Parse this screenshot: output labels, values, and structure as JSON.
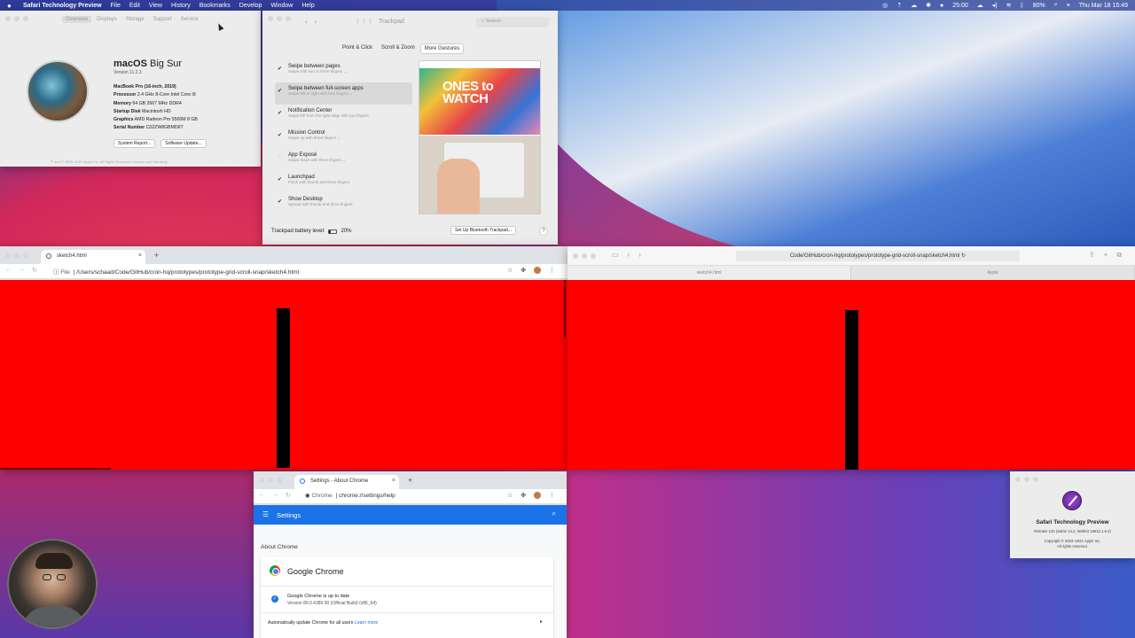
{
  "menubar": {
    "app_name": "Safari Technology Preview",
    "items": [
      "File",
      "Edit",
      "View",
      "History",
      "Bookmarks",
      "Develop",
      "Window",
      "Help"
    ],
    "timer": "25:00",
    "battery": "80%",
    "datetime": "Thu Mar 18  15:49"
  },
  "about_mac": {
    "tabs": [
      "Overview",
      "Displays",
      "Storage",
      "Support",
      "Service"
    ],
    "os_name_prefix": "macOS",
    "os_name_suffix": "Big Sur",
    "version": "Version 11.2.3",
    "model": "MacBook Pro (16-inch, 2019)",
    "specs": [
      {
        "k": "Processor",
        "v": "2.4 GHz 8-Core Intel Core i9"
      },
      {
        "k": "Memory",
        "v": "64 GB 2667 MHz DDR4"
      },
      {
        "k": "Startup Disk",
        "v": "Macintosh HD"
      },
      {
        "k": "Graphics",
        "v": "AMD Radeon Pro 5500M 8 GB"
      },
      {
        "k": "Serial Number",
        "v": "C02ZW8GBMD6T"
      }
    ],
    "system_report": "System Report...",
    "software_update": "Software Update...",
    "footer": "™ and © 1983–2021 Apple Inc. All Rights Reserved. License and Warranty"
  },
  "trackpad": {
    "title": "Trackpad",
    "search_placeholder": "Search",
    "tabs": [
      "Point & Click",
      "Scroll & Zoom",
      "More Gestures"
    ],
    "selected_tab": "More Gestures",
    "options": [
      {
        "name": "Swipe between pages",
        "desc": "Swipe with two or three fingers ⌄"
      },
      {
        "name": "Swipe between full-screen apps",
        "desc": "Swipe left or right with four fingers ⌄"
      },
      {
        "name": "Notification Center",
        "desc": "Swipe left from the right edge with two fingers"
      },
      {
        "name": "Mission Control",
        "desc": "Swipe up with three fingers ⌄"
      },
      {
        "name": "App Exposé",
        "desc": "Swipe down with three fingers ⌄"
      },
      {
        "name": "Launchpad",
        "desc": "Pinch with thumb and three fingers"
      },
      {
        "name": "Show Desktop",
        "desc": "Spread with thumb and three fingers"
      }
    ],
    "preview_text": "ONES to WATCH",
    "battery_label": "Trackpad battery level:",
    "battery_value": "20%",
    "battery_level": 0.2,
    "setup_button": "Set Up Bluetooth Trackpad...",
    "help": "?"
  },
  "chrome_left": {
    "tab_title": "sketch4.html",
    "scheme": "File",
    "url": "/Users/schaad/Code/GitHub/cron-hq/prototypes/prototype-grid-scroll-snap/sketch4.html"
  },
  "safari_right": {
    "url": "Code/GitHub/cron-hq/prototypes/prototype-grid-scroll-snap/sketch4.html",
    "tabs": [
      "sketch4.html",
      "Apple"
    ]
  },
  "chrome_settings": {
    "tab_title": "Settings - About Chrome",
    "scheme": "Chrome",
    "url": "chrome://settings/help",
    "header": "Settings",
    "section": "About Chrome",
    "product": "Google Chrome",
    "status": "Google Chrome is up to date",
    "version": "Version 89.0.4389.90 (Official Build) (x86_64)",
    "auto_update": "Automatically update Chrome for all users",
    "learn_more": "Learn more"
  },
  "stp_about": {
    "name": "Safari Technology Preview",
    "release": "Release 122 (Safari 14.2, WebKit 16612.1.6.2)",
    "copyright": "Copyright © 2003–2021 Apple Inc.",
    "rights": "All rights reserved."
  }
}
